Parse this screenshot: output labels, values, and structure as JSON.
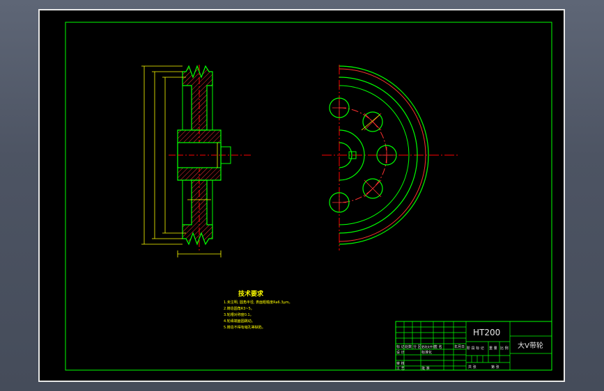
{
  "title_block": {
    "material": "HT200",
    "part_name": "大V带轮",
    "row_labels_left": [
      "标 记",
      "处数",
      "分 区",
      "更改文件号",
      "签 名",
      "年月日"
    ],
    "designer_label": "设 计",
    "standard_label": "标准化",
    "review_label": "审 核",
    "process_label": "工 艺",
    "approve_label": "批 准",
    "stage_label": "阶 段 标 记",
    "weight_label": "重 量",
    "scale_label": "比 例",
    "sheet_total_label": "共 张",
    "sheet_no_label": "第 张"
  },
  "technical_requirements": {
    "heading": "技术要求",
    "lines": [
      "1.未注明, 圆角半径, 表面粗糙度Ra6.3μm。",
      "2.铸造圆角R3~5。",
      "3.轮槽对称度0.1。",
      "4.轮缘端面圆跳动。",
      "5.铸造不得有缩孔等缺陷。"
    ]
  },
  "colors": {
    "frame": "#00ff00",
    "outline": "#00ff00",
    "centerline": "#ff0000",
    "hatch": "#ff3030",
    "dimension": "#ffff00",
    "text": "#ffff00",
    "sheet_bg": "#000000",
    "window_bg": "#4d5463"
  }
}
